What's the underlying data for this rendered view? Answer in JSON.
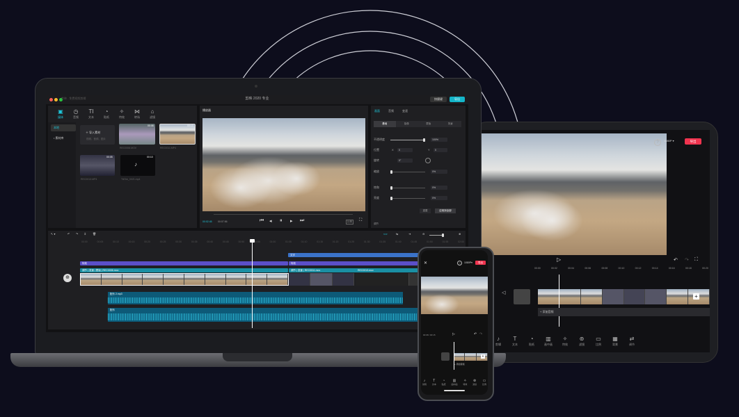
{
  "app": {
    "window_title": "剪映 2020 专业",
    "muted_title": "剪映 - 免费视频剪辑",
    "shortcut_label": "快捷键",
    "export_label": "导出"
  },
  "media": {
    "tabs": [
      {
        "label": "媒体",
        "icon": "media-icon"
      },
      {
        "label": "音频",
        "icon": "audio-icon"
      },
      {
        "label": "文本",
        "icon": "text-icon"
      },
      {
        "label": "贴纸",
        "icon": "sticker-icon"
      },
      {
        "label": "特效",
        "icon": "effect-icon"
      },
      {
        "label": "转场",
        "icon": "transition-icon"
      },
      {
        "label": "滤镜",
        "icon": "filter-icon"
      }
    ],
    "sidebar": [
      "本地",
      "• 素材库"
    ],
    "import_label": "导入素材",
    "import_hint": "视频、音频、图片",
    "clips": [
      {
        "name": "REC0006.MOV",
        "duration": "00:08"
      },
      {
        "name": "REC0011.MP4",
        "duration": "00:13"
      },
      {
        "name": "REC0013.MP4",
        "duration": "00:05"
      },
      {
        "name": "TikTok_0021.mp4",
        "duration": "00:10"
      }
    ]
  },
  "player": {
    "title": "播放器",
    "current_time": "00:02:45",
    "total_time": "00:07:56",
    "ratio_label": "比例"
  },
  "props": {
    "tabs": [
      "画面",
      "音频",
      "变速"
    ],
    "subtabs": [
      "基础",
      "抠像",
      "蒙版",
      "背景"
    ],
    "rows": [
      {
        "label": "不透明度",
        "value": "100%"
      },
      {
        "label": "位置",
        "x_label": "X",
        "x": "0",
        "y_label": "Y",
        "y": "0"
      },
      {
        "label": "旋转",
        "value": "0°"
      },
      {
        "label": "缩放",
        "value": "0%"
      },
      {
        "label": "饱和",
        "value": "0%"
      },
      {
        "label": "亮度",
        "value": "0%"
      }
    ],
    "reset_label": "重置",
    "apply_label": "应用到全部",
    "footer_label": "调节"
  },
  "timeline": {
    "time_marks": [
      "00:00",
      "00:05",
      "00:10",
      "00:15",
      "00:20",
      "00:25",
      "00:30",
      "00:35",
      "00:40",
      "00:45",
      "00:50",
      "00:55",
      "01:00",
      "01:05",
      "01:10",
      "01:15",
      "01:20",
      "01:25",
      "01:30",
      "01:35",
      "01:40",
      "01:45",
      "01:50",
      "01:55",
      "02:00"
    ],
    "tracks": {
      "text_track": "文字",
      "effect_track_1": "特效",
      "effect_track_2": "特效",
      "main_clip_tags": "调节 | 变速 | 蒙版 | REC0006.mov",
      "second_clip_tags": "调节 | 变速 | REC0011.mov",
      "third_clip_name": "REC0013.mov",
      "audio_1": "配乐 2.mp3",
      "audio_2": "配乐"
    }
  },
  "tablet": {
    "resolution": "1080P",
    "export_label": "导出",
    "add_audio_label": "+ 添加音频",
    "toolbar": [
      {
        "label": "剪辑",
        "icon": "music-note-icon"
      },
      {
        "label": "文本",
        "icon": "text-icon"
      },
      {
        "label": "贴纸",
        "icon": "sticker-icon"
      },
      {
        "label": "画中画",
        "icon": "pip-icon"
      },
      {
        "label": "特效",
        "icon": "effect-icon"
      },
      {
        "label": "滤镜",
        "icon": "filter-icon"
      },
      {
        "label": "比例",
        "icon": "ratio-icon"
      },
      {
        "label": "背景",
        "icon": "background-icon"
      },
      {
        "label": "调节",
        "icon": "adjust-icon"
      }
    ],
    "ruler": [
      "00:00",
      "00:02",
      "00:04",
      "00:06",
      "00:08",
      "00:10",
      "00:12",
      "00:14",
      "00:16",
      "00:18",
      "00:20"
    ]
  },
  "phone": {
    "resolution": "1080P",
    "export_label": "导出",
    "time": "00:08 / 00:15",
    "add_audio_label": "+ 添加音频",
    "toolbar": [
      "剪辑",
      "文本",
      "贴纸",
      "画中画",
      "特效",
      "滤镜",
      "比例"
    ]
  },
  "colors": {
    "background": "#0d0d1c",
    "accent": "#1ec8dc",
    "export_red": "#f0344f",
    "purple_track": "#5b4fc9",
    "teal_track": "#1a8fa3"
  }
}
